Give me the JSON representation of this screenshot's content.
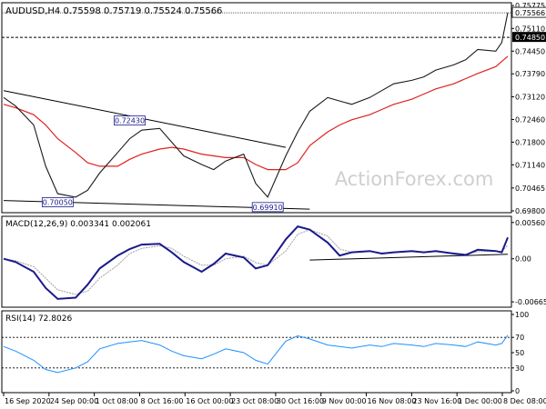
{
  "chart_data": {
    "type": "line",
    "symbol_header": "AUDUSD,H4  0.75598 0.75719 0.75524 0.75566",
    "watermark": "ActionForex.com",
    "x_dates": [
      "2020-09-16",
      "2020-09-18",
      "2020-09-21",
      "2020-09-23",
      "2020-09-25",
      "2020-09-28",
      "2020-09-30",
      "2020-10-02",
      "2020-10-05",
      "2020-10-07",
      "2020-10-09",
      "2020-10-12",
      "2020-10-14",
      "2020-10-16",
      "2020-10-19",
      "2020-10-21",
      "2020-10-23",
      "2020-10-26",
      "2020-10-28",
      "2020-10-30",
      "2020-11-02",
      "2020-11-04",
      "2020-11-06",
      "2020-11-09",
      "2020-11-11",
      "2020-11-13",
      "2020-11-16",
      "2020-11-18",
      "2020-11-20",
      "2020-11-23",
      "2020-11-25",
      "2020-11-27",
      "2020-11-30",
      "2020-12-02",
      "2020-12-04",
      "2020-12-07",
      "2020-12-08",
      "2020-12-09"
    ],
    "x_tick_labels": [
      "16 Sep 2020",
      "24 Sep 00:00",
      "1 Oct 08:00",
      "8 Oct 16:00",
      "16 Oct 00:00",
      "23 Oct 08:00",
      "30 Oct 16:00",
      "9 Nov 00:00",
      "16 Nov 08:00",
      "23 Nov 16:00",
      "1 Dec 00:00",
      "8 Dec 08:00"
    ],
    "main": {
      "ylim": [
        0.698,
        0.7578
      ],
      "y_ticks": [
        "0.75775",
        "0.75110",
        "0.74450",
        "0.73790",
        "0.73120",
        "0.72460",
        "0.71800",
        "0.71140",
        "0.70465",
        "0.69800"
      ],
      "price": [
        0.731,
        0.7285,
        0.723,
        0.711,
        0.703,
        0.702,
        0.704,
        0.709,
        0.715,
        0.719,
        0.7215,
        0.722,
        0.718,
        0.714,
        0.7115,
        0.71,
        0.7125,
        0.7145,
        0.706,
        0.702,
        0.714,
        0.721,
        0.727,
        0.731,
        0.73,
        0.729,
        0.731,
        0.733,
        0.735,
        0.736,
        0.737,
        0.739,
        0.7405,
        0.742,
        0.745,
        0.7445,
        0.747,
        0.7557
      ],
      "ma": [
        0.729,
        0.728,
        0.726,
        0.723,
        0.719,
        0.715,
        0.712,
        0.711,
        0.711,
        0.713,
        0.7145,
        0.716,
        0.7165,
        0.716,
        0.7145,
        0.714,
        0.7135,
        0.7135,
        0.7115,
        0.71,
        0.71,
        0.712,
        0.717,
        0.721,
        0.723,
        0.7245,
        0.726,
        0.7275,
        0.729,
        0.7305,
        0.732,
        0.7335,
        0.735,
        0.7365,
        0.738,
        0.74,
        0.7415,
        0.743
      ],
      "annotations": [
        {
          "label": "0.72430",
          "x": "2020-10-07",
          "y": 0.7243
        },
        {
          "label": "0.70050",
          "x": "2020-09-25",
          "y": 0.7005
        },
        {
          "label": "0.69910",
          "x": "2020-10-30",
          "y": 0.6991
        }
      ],
      "trendlines": [
        {
          "x1": "2020-09-16",
          "y1": 0.733,
          "x2": "2020-11-02",
          "y2": 0.7165
        },
        {
          "x1": "2020-09-16",
          "y1": 0.701,
          "x2": "2020-11-06",
          "y2": 0.6985
        }
      ],
      "hline_value": 0.7485,
      "last_value": 0.75566,
      "price_label": "0.75566",
      "hline_label": "0.74850"
    },
    "macd": {
      "header": "MACD(12,26,9) 0.003341 0.002061",
      "ylim": [
        -0.0072,
        0.006
      ],
      "y_ticks": [
        "0.005607",
        "0.00",
        "-0.006656"
      ],
      "macd": [
        0.0,
        -0.0005,
        -0.002,
        -0.0045,
        -0.0062,
        -0.006,
        -0.004,
        -0.0015,
        0.0005,
        0.0015,
        0.0022,
        0.0023,
        0.001,
        -0.0005,
        -0.002,
        -0.0008,
        0.0008,
        0.0002,
        -0.0015,
        -0.001,
        0.003,
        0.005,
        0.0045,
        0.0025,
        0.0005,
        0.001,
        0.0012,
        0.0008,
        0.001,
        0.0012,
        0.001,
        0.0012,
        0.0008,
        0.0006,
        0.0014,
        0.0012,
        0.001,
        0.0033
      ],
      "signal": [
        0.0,
        -0.0003,
        -0.0012,
        -0.003,
        -0.0048,
        -0.0055,
        -0.005,
        -0.003,
        -0.001,
        0.0008,
        0.0016,
        0.002,
        0.0016,
        0.0004,
        -0.001,
        -0.001,
        0.0,
        0.0004,
        -0.0006,
        -0.001,
        0.0012,
        0.0038,
        0.0045,
        0.0035,
        0.0015,
        0.001,
        0.0011,
        0.0009,
        0.001,
        0.0011,
        0.001,
        0.0011,
        0.0009,
        0.0007,
        0.0011,
        0.0012,
        0.0011,
        0.0021
      ],
      "trendline": {
        "x1": "2020-11-06",
        "y1": -0.0002,
        "x2": "2020-12-09",
        "y2": 0.0007
      }
    },
    "rsi": {
      "header": "RSI(14) 72.8026",
      "ylim": [
        0,
        100
      ],
      "y_ticks": [
        "100",
        "70",
        "50",
        "30",
        "0"
      ],
      "values": [
        58,
        52,
        40,
        28,
        24,
        30,
        38,
        55,
        62,
        64,
        66,
        60,
        52,
        46,
        42,
        48,
        55,
        50,
        40,
        35,
        65,
        72,
        68,
        60,
        58,
        56,
        60,
        58,
        62,
        60,
        58,
        62,
        60,
        58,
        64,
        60,
        62,
        72.8
      ]
    }
  }
}
